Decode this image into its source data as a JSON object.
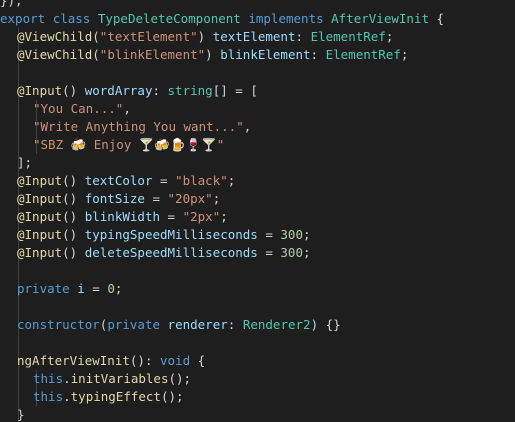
{
  "editor": {
    "lines": [
      {
        "indent": 0,
        "tokens": [
          {
            "t": "});",
            "c": "punc"
          }
        ]
      },
      {
        "indent": 0,
        "tokens": [
          {
            "t": "export ",
            "c": "kw"
          },
          {
            "t": "class ",
            "c": "kw"
          },
          {
            "t": "TypeDeleteComponent ",
            "c": "cls"
          },
          {
            "t": "implements ",
            "c": "kw"
          },
          {
            "t": "AfterViewInit",
            "c": "cls"
          },
          {
            "t": " {",
            "c": "punc"
          }
        ]
      },
      {
        "indent": 1,
        "tokens": [
          {
            "t": "@ViewChild",
            "c": "dec"
          },
          {
            "t": "(",
            "c": "punc"
          },
          {
            "t": "\"textElement\"",
            "c": "str"
          },
          {
            "t": ") ",
            "c": "punc"
          },
          {
            "t": "textElement",
            "c": "var"
          },
          {
            "t": ": ",
            "c": "punc"
          },
          {
            "t": "ElementRef",
            "c": "cls"
          },
          {
            "t": ";",
            "c": "punc"
          }
        ]
      },
      {
        "indent": 1,
        "tokens": [
          {
            "t": "@ViewChild",
            "c": "dec"
          },
          {
            "t": "(",
            "c": "punc"
          },
          {
            "t": "\"blinkElement\"",
            "c": "str"
          },
          {
            "t": ") ",
            "c": "punc"
          },
          {
            "t": "blinkElement",
            "c": "var"
          },
          {
            "t": ": ",
            "c": "punc"
          },
          {
            "t": "ElementRef",
            "c": "cls"
          },
          {
            "t": ";",
            "c": "punc"
          }
        ]
      },
      {
        "indent": 1,
        "tokens": []
      },
      {
        "indent": 1,
        "tokens": [
          {
            "t": "@Input",
            "c": "dec"
          },
          {
            "t": "() ",
            "c": "punc"
          },
          {
            "t": "wordArray",
            "c": "var"
          },
          {
            "t": ": ",
            "c": "punc"
          },
          {
            "t": "string",
            "c": "cls"
          },
          {
            "t": "[] = [",
            "c": "punc"
          }
        ]
      },
      {
        "indent": 2,
        "tokens": [
          {
            "t": "\"You Can...\"",
            "c": "str"
          },
          {
            "t": ",",
            "c": "punc"
          }
        ]
      },
      {
        "indent": 2,
        "tokens": [
          {
            "t": "\"Write Anything You want...\"",
            "c": "str"
          },
          {
            "t": ",",
            "c": "punc"
          }
        ]
      },
      {
        "indent": 2,
        "tokens": [
          {
            "t": "\"SBZ 🍻 Enjoy 🍸🍻🍺🍷🍸\"",
            "c": "str"
          }
        ]
      },
      {
        "indent": 1,
        "tokens": [
          {
            "t": "];",
            "c": "punc"
          }
        ]
      },
      {
        "indent": 1,
        "tokens": [
          {
            "t": "@Input",
            "c": "dec"
          },
          {
            "t": "() ",
            "c": "punc"
          },
          {
            "t": "textColor",
            "c": "var"
          },
          {
            "t": " = ",
            "c": "punc"
          },
          {
            "t": "\"black\"",
            "c": "str"
          },
          {
            "t": ";",
            "c": "punc"
          }
        ]
      },
      {
        "indent": 1,
        "tokens": [
          {
            "t": "@Input",
            "c": "dec"
          },
          {
            "t": "() ",
            "c": "punc"
          },
          {
            "t": "fontSize",
            "c": "var"
          },
          {
            "t": " = ",
            "c": "punc"
          },
          {
            "t": "\"20px\"",
            "c": "str"
          },
          {
            "t": ";",
            "c": "punc"
          }
        ]
      },
      {
        "indent": 1,
        "tokens": [
          {
            "t": "@Input",
            "c": "dec"
          },
          {
            "t": "() ",
            "c": "punc"
          },
          {
            "t": "blinkWidth",
            "c": "var"
          },
          {
            "t": " = ",
            "c": "punc"
          },
          {
            "t": "\"2px\"",
            "c": "str"
          },
          {
            "t": ";",
            "c": "punc"
          }
        ]
      },
      {
        "indent": 1,
        "tokens": [
          {
            "t": "@Input",
            "c": "dec"
          },
          {
            "t": "() ",
            "c": "punc"
          },
          {
            "t": "typingSpeedMilliseconds",
            "c": "var"
          },
          {
            "t": " = ",
            "c": "punc"
          },
          {
            "t": "300",
            "c": "num"
          },
          {
            "t": ";",
            "c": "punc"
          }
        ]
      },
      {
        "indent": 1,
        "tokens": [
          {
            "t": "@Input",
            "c": "dec"
          },
          {
            "t": "() ",
            "c": "punc"
          },
          {
            "t": "deleteSpeedMilliseconds",
            "c": "var"
          },
          {
            "t": " = ",
            "c": "punc"
          },
          {
            "t": "300",
            "c": "num"
          },
          {
            "t": ";",
            "c": "punc"
          }
        ]
      },
      {
        "indent": 1,
        "tokens": []
      },
      {
        "indent": 1,
        "tokens": [
          {
            "t": "private ",
            "c": "kw"
          },
          {
            "t": "i",
            "c": "var"
          },
          {
            "t": " = ",
            "c": "punc"
          },
          {
            "t": "0",
            "c": "num"
          },
          {
            "t": ";",
            "c": "punc"
          }
        ]
      },
      {
        "indent": 1,
        "tokens": []
      },
      {
        "indent": 1,
        "tokens": [
          {
            "t": "constructor",
            "c": "kw"
          },
          {
            "t": "(",
            "c": "punc"
          },
          {
            "t": "private ",
            "c": "kw"
          },
          {
            "t": "renderer",
            "c": "var"
          },
          {
            "t": ": ",
            "c": "punc"
          },
          {
            "t": "Renderer2",
            "c": "cls"
          },
          {
            "t": ") {}",
            "c": "punc"
          }
        ]
      },
      {
        "indent": 1,
        "tokens": []
      },
      {
        "indent": 1,
        "tokens": [
          {
            "t": "ngAfterViewInit",
            "c": "fn"
          },
          {
            "t": "(): ",
            "c": "punc"
          },
          {
            "t": "void",
            "c": "kw"
          },
          {
            "t": " {",
            "c": "punc"
          }
        ]
      },
      {
        "indent": 2,
        "tokens": [
          {
            "t": "this",
            "c": "this"
          },
          {
            "t": ".",
            "c": "punc"
          },
          {
            "t": "initVariables",
            "c": "fn"
          },
          {
            "t": "();",
            "c": "punc"
          }
        ]
      },
      {
        "indent": 2,
        "tokens": [
          {
            "t": "this",
            "c": "this"
          },
          {
            "t": ".",
            "c": "punc"
          },
          {
            "t": "typingEffect",
            "c": "fn"
          },
          {
            "t": "();",
            "c": "punc"
          }
        ]
      },
      {
        "indent": 1,
        "tokens": [
          {
            "t": "}",
            "c": "punc"
          }
        ]
      }
    ]
  },
  "colors": {
    "background": "#1e1e1e",
    "keyword": "#569cd6",
    "class": "#4ec9b0",
    "decorator": "#dcdcaa",
    "string": "#ce9178",
    "variable": "#9cdcfe",
    "number": "#b5cea8",
    "punctuation": "#d4d4d4"
  }
}
